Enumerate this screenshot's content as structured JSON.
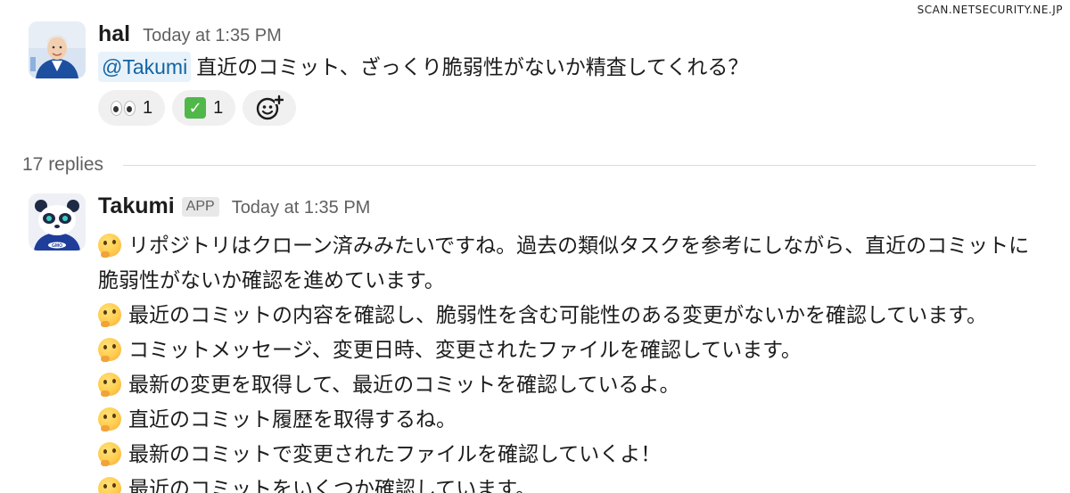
{
  "watermark": "SCAN.NETSECURITY.NE.JP",
  "parent_message": {
    "sender": "hal",
    "timestamp": "Today at 1:35 PM",
    "mention": "@Takumi",
    "text": "直近のコミット、ざっくり脆弱性がないか精査してくれる？",
    "reactions": [
      {
        "emoji": "eyes-emoji",
        "count": "1"
      },
      {
        "emoji": "white-check-mark-emoji",
        "count": "1"
      }
    ],
    "add_reaction_icon": "add-reaction-icon"
  },
  "thread": {
    "replies_label": "17 replies"
  },
  "reply": {
    "sender": "Takumi",
    "badge": "APP",
    "timestamp": "Today at 1:35 PM",
    "avatar_label": "GMO",
    "lines": [
      "リポジトリはクローン済みみたいですね。過去の類似タスクを参考にしながら、直近のコミットに",
      "脆弱性がないか確認を進めています。",
      "最近のコミットの内容を確認し、脆弱性を含む可能性のある変更がないかを確認しています。",
      "コミットメッセージ、変更日時、変更されたファイルを確認しています。",
      "最新の変更を取得して、最近のコミットを確認しているよ。",
      "直近のコミット履歴を取得するね。",
      "最新のコミットで変更されたファイルを確認していくよ！",
      "最近のコミットをいくつか確認しています。"
    ],
    "line_has_emoji": [
      true,
      false,
      true,
      true,
      true,
      true,
      true,
      true
    ],
    "emoji": "thinking-face-emoji"
  }
}
